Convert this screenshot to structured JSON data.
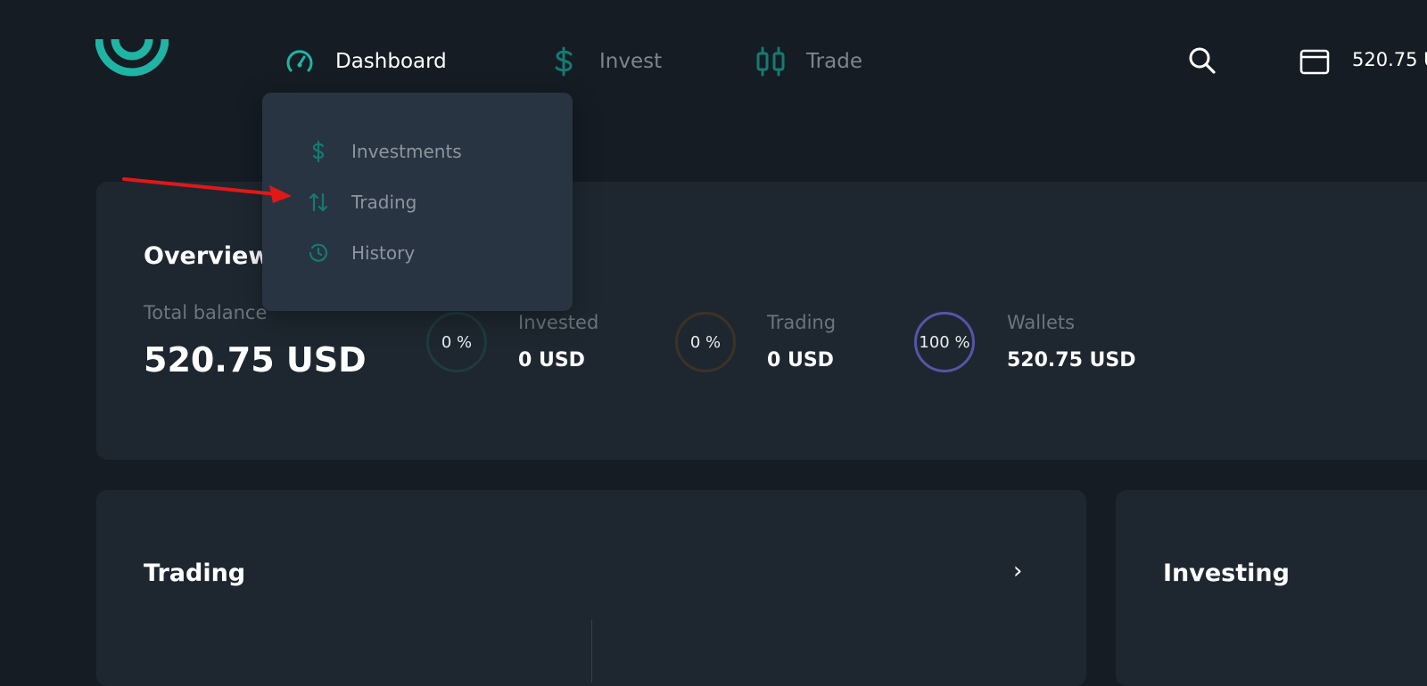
{
  "nav": {
    "items": [
      {
        "label": "Dashboard",
        "icon": "speedometer-icon"
      },
      {
        "label": "Invest",
        "icon": "dollar-icon"
      },
      {
        "label": "Trade",
        "icon": "candlestick-icon"
      }
    ],
    "balance": "520.75 U"
  },
  "dropdown": {
    "items": [
      {
        "label": "Investments",
        "icon": "dollar-icon"
      },
      {
        "label": "Trading",
        "icon": "arrows-up-down-icon"
      },
      {
        "label": "History",
        "icon": "clock-icon"
      }
    ]
  },
  "overview": {
    "title": "Overview",
    "total_label": "Total balance",
    "total_value": "520.75 USD",
    "stats": [
      {
        "percent": "0 %",
        "label": "Invested",
        "value": "0 USD"
      },
      {
        "percent": "0 %",
        "label": "Trading",
        "value": "0 USD"
      },
      {
        "percent": "100 %",
        "label": "Wallets",
        "value": "520.75 USD"
      }
    ]
  },
  "cards": {
    "trading_title": "Trading",
    "trading_chevron": "›",
    "investing_title": "Investing"
  },
  "colors": {
    "background": "#151c24",
    "card": "#1e2730",
    "dropdown": "#283441",
    "accent_teal": "#1fb5a5",
    "wallets_ring": "#5455a8",
    "annotation_red": "#e01818"
  }
}
